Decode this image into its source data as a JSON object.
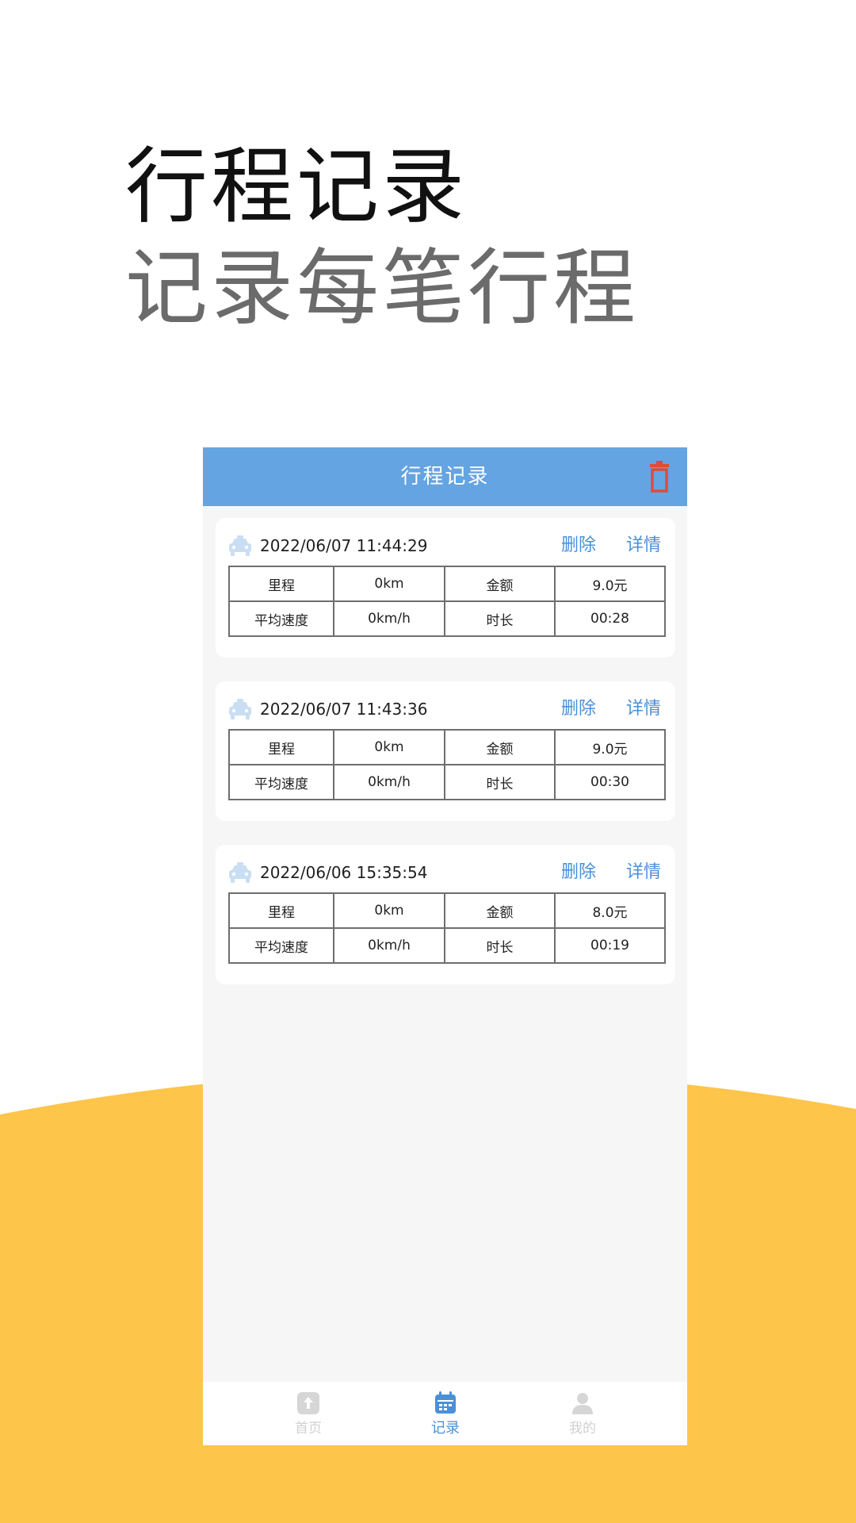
{
  "promo": {
    "title": "行程记录",
    "subtitle": "记录每笔行程"
  },
  "app": {
    "header_title": "行程记录",
    "header_icon": "trash-icon",
    "accent_color": "#64a4e2",
    "trips": [
      {
        "datetime": "2022/06/07 11:44:29",
        "delete_label": "删除",
        "detail_label": "详情",
        "mileage_label": "里程",
        "mileage_value": "0km",
        "amount_label": "金额",
        "amount_value": "9.0元",
        "avg_speed_label": "平均速度",
        "avg_speed_value": "0km/h",
        "duration_label": "时长",
        "duration_value": "00:28"
      },
      {
        "datetime": "2022/06/07 11:43:36",
        "delete_label": "删除",
        "detail_label": "详情",
        "mileage_label": "里程",
        "mileage_value": "0km",
        "amount_label": "金额",
        "amount_value": "9.0元",
        "avg_speed_label": "平均速度",
        "avg_speed_value": "0km/h",
        "duration_label": "时长",
        "duration_value": "00:30"
      },
      {
        "datetime": "2022/06/06 15:35:54",
        "delete_label": "删除",
        "detail_label": "详情",
        "mileage_label": "里程",
        "mileage_value": "0km",
        "amount_label": "金额",
        "amount_value": "8.0元",
        "avg_speed_label": "平均速度",
        "avg_speed_value": "0km/h",
        "duration_label": "时长",
        "duration_value": "00:19"
      }
    ],
    "tabs": [
      {
        "label": "首页",
        "icon": "home-upload-icon",
        "active": false
      },
      {
        "label": "记录",
        "icon": "calendar-icon",
        "active": true
      },
      {
        "label": "我的",
        "icon": "user-icon",
        "active": false
      }
    ]
  }
}
